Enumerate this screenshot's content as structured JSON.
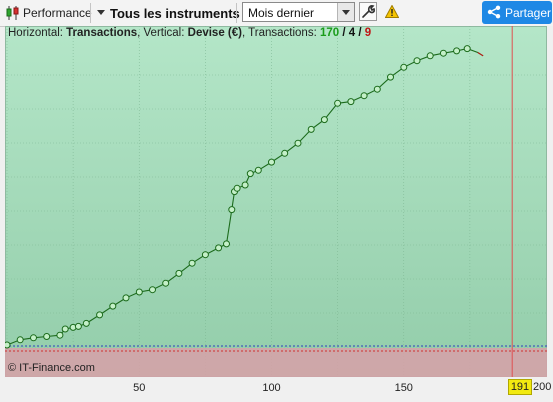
{
  "toolbar": {
    "performance_label": "Performance",
    "instruments_label": "Tous les instruments",
    "period_value": "Mois dernier",
    "share_label": "Partager",
    "icons": [
      "candlestick-icon",
      "chevron-down-icon",
      "wrench-icon",
      "warning-icon",
      "share-icon"
    ]
  },
  "chart_header": {
    "horizontal_prefix": "Horizontal:",
    "horizontal_value": "Transactions",
    "vertical_prefix": ", Vertical:",
    "vertical_value": "Devise (€)",
    "transactions_prefix": ", Transactions:",
    "count_total": "170",
    "slash1": " / ",
    "count_mid": "4",
    "slash2": " / ",
    "count_red": "9"
  },
  "copyright": "© IT-Finance.com",
  "x_axis": {
    "tick_labels": [
      "50",
      "100",
      "150"
    ],
    "cursor_value": "191",
    "end_label": "200"
  },
  "colors": {
    "line": "#1c6b1c",
    "marker_fill": "#c4f0c8",
    "cursor": "#e05050",
    "zero_band": "#d8a0a8",
    "badge": "#f2ea10",
    "share": "#1e88e5"
  },
  "chart_data": {
    "type": "line",
    "title": "",
    "xlabel": "Transactions",
    "ylabel": "Devise (€)",
    "xlim": [
      0,
      200
    ],
    "x_ticks": [
      50,
      100,
      150
    ],
    "cursor_x": 191,
    "series": [
      {
        "x": [
          0,
          5,
          10,
          15,
          20,
          22,
          25,
          27,
          30,
          35,
          40,
          45,
          50,
          55,
          60,
          65,
          70,
          75,
          80,
          83,
          85,
          86,
          87,
          90,
          92,
          95,
          100,
          105,
          110,
          115,
          120,
          125,
          130,
          135,
          140,
          145,
          150,
          155,
          160,
          165,
          170,
          174,
          178,
          180
        ],
        "y": [
          0.6,
          2.2,
          2.8,
          3.2,
          3.6,
          5.5,
          6.0,
          6.3,
          7.2,
          9.8,
          12.5,
          15.0,
          16.8,
          17.5,
          19.5,
          22.5,
          25.6,
          28.2,
          30.3,
          31.5,
          42,
          47.5,
          48.5,
          49.5,
          53.0,
          54.0,
          56.5,
          59.2,
          62.3,
          66.5,
          69.5,
          74.5,
          75.0,
          76.8,
          78.8,
          82.5,
          85.5,
          87.5,
          89.0,
          89.8,
          90.5,
          91.2,
          90.0,
          89.0
        ]
      }
    ]
  }
}
